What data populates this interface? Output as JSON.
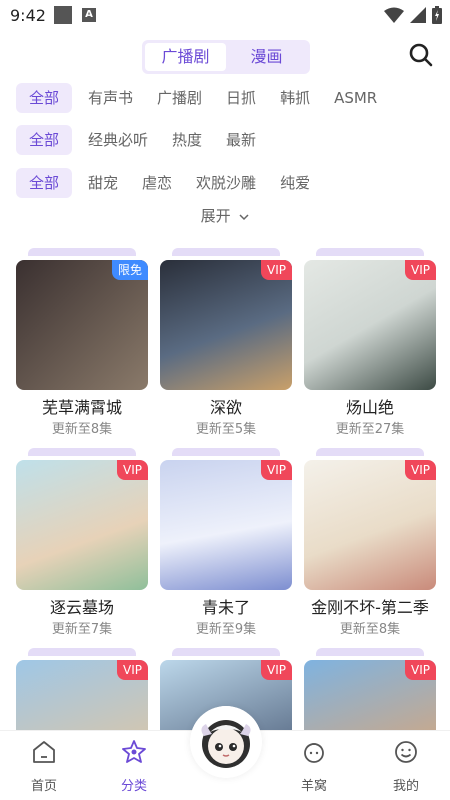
{
  "status_bar": {
    "time": "9:42",
    "a_icon": "A"
  },
  "header": {
    "tabs": [
      {
        "label": "广播剧",
        "active": true
      },
      {
        "label": "漫画",
        "active": false
      }
    ]
  },
  "filters": {
    "row1": [
      "全部",
      "有声书",
      "广播剧",
      "日抓",
      "韩抓",
      "ASMR"
    ],
    "row2": [
      "全部",
      "经典必听",
      "热度",
      "最新"
    ],
    "row3": [
      "全部",
      "甜宠",
      "虐恋",
      "欢脱沙雕",
      "纯爱"
    ],
    "expand_label": "展开"
  },
  "cards": [
    {
      "title": "芜草满霄城",
      "sub": "更新至8集",
      "badge": "限免",
      "badge_type": "free",
      "colors": [
        "#3a3030",
        "#8a7a6a"
      ]
    },
    {
      "title": "深欲",
      "sub": "更新至5集",
      "badge": "VIP",
      "badge_type": "vip",
      "colors": [
        "#2a2f3a",
        "#c9a06a"
      ]
    },
    {
      "title": "炀山绝",
      "sub": "更新至27集",
      "badge": "VIP",
      "badge_type": "vip",
      "colors": [
        "#cfd6d2",
        "#3c4a44"
      ]
    },
    {
      "title": "逐云墓场",
      "sub": "更新至7集",
      "badge": "VIP",
      "badge_type": "vip",
      "colors": [
        "#bfe0ea",
        "#e7d2b8"
      ]
    },
    {
      "title": "青未了",
      "sub": "更新至9集",
      "badge": "VIP",
      "badge_type": "vip",
      "colors": [
        "#c9d3ef",
        "#7d8ed0"
      ]
    },
    {
      "title": "金刚不坏-第二季",
      "sub": "更新至8集",
      "badge": "VIP",
      "badge_type": "vip",
      "colors": [
        "#f4f1ea",
        "#c98a7a"
      ]
    },
    {
      "title": "",
      "sub": "",
      "badge": "VIP",
      "badge_type": "vip",
      "colors": [
        "#9fc7e6",
        "#e8c59a"
      ]
    },
    {
      "title": "",
      "sub": "",
      "badge": "VIP",
      "badge_type": "vip",
      "colors": [
        "#bcd7ea",
        "#3e4e6a"
      ]
    },
    {
      "title": "",
      "sub": "",
      "badge": "VIP",
      "badge_type": "vip",
      "colors": [
        "#7fb3e0",
        "#e6a46a"
      ]
    }
  ],
  "bottom_nav": [
    {
      "label": "首页",
      "icon": "home-icon",
      "active": false
    },
    {
      "label": "分类",
      "icon": "category-icon",
      "active": true
    },
    {
      "label": "羊窝",
      "icon": "sheep-icon",
      "active": false
    },
    {
      "label": "我的",
      "icon": "profile-icon",
      "active": false
    }
  ],
  "accent_color": "#6b4ad6"
}
